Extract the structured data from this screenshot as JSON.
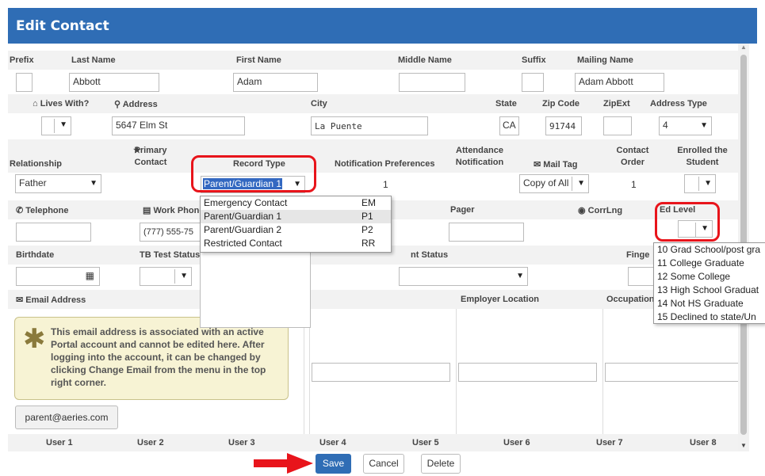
{
  "title": "Edit Contact",
  "row1": {
    "headers": {
      "prefix": "Prefix",
      "last_name": "Last Name",
      "first_name": "First Name",
      "middle_name": "Middle Name",
      "suffix": "Suffix",
      "mailing_name": "Mailing Name"
    },
    "values": {
      "prefix": "",
      "last_name": "Abbott",
      "first_name": "Adam",
      "middle_name": "",
      "suffix": "",
      "mailing_name": "Adam Abbott"
    }
  },
  "row2": {
    "headers": {
      "lives_with": "Lives With?",
      "address": "Address",
      "city": "City",
      "state": "State",
      "zip": "Zip Code",
      "zipext": "ZipExt",
      "address_type": "Address Type"
    },
    "values": {
      "lives_with": "",
      "address": "5647 Elm St",
      "city": "La Puente",
      "state": "CA",
      "zip": "91744",
      "zipext": "",
      "address_type": "4"
    }
  },
  "row3": {
    "headers": {
      "relationship": "Relationship",
      "primary_contact": "Primary\nContact",
      "record_type": "Record Type",
      "notification_prefs": "Notification Preferences",
      "attendance": "Attendance\nNotification",
      "mail_tag": "Mail Tag",
      "contact_order": "Contact\nOrder",
      "enrolled": "Enrolled the\nStudent"
    },
    "values": {
      "relationship": "Father",
      "record_type": "Parent/Guardian 1",
      "notification_prefs": "1",
      "mail_tag": "Copy of All",
      "contact_order": "1",
      "enrolled": ""
    }
  },
  "row4": {
    "headers": {
      "telephone": "Telephone",
      "work_phone": "Work Phone",
      "pager": "Pager",
      "corrlng": "CorrLng",
      "ed_level": "Ed Level"
    },
    "values": {
      "telephone": "",
      "work_phone": "(777) 555-75",
      "pager": "",
      "ed_level": ""
    }
  },
  "row5": {
    "headers": {
      "birthdate": "Birthdate",
      "tb_test": "TB Test Status",
      "status": "nt Status",
      "finger": "Finge"
    },
    "values": {
      "birthdate": "",
      "tb_test": ""
    }
  },
  "row6": {
    "headers": {
      "email": "Email Address",
      "employer_location": "Employer Location",
      "occupation": "Occupation"
    },
    "warning": "This email address is associated with an active Portal account and cannot be edited here. After logging into the account, it can be changed by clicking Change Email from the menu in the top right corner.",
    "email_value": "parent@aeries.com"
  },
  "user_headers": [
    "User 1",
    "User 2",
    "User 3",
    "User 4",
    "User 5",
    "User 6",
    "User 7",
    "User 8"
  ],
  "record_type_options": [
    {
      "label": "Emergency Contact",
      "code": "EM"
    },
    {
      "label": "Parent/Guardian 1",
      "code": "P1"
    },
    {
      "label": "Parent/Guardian 2",
      "code": "P2"
    },
    {
      "label": "Restricted Contact",
      "code": "RR"
    }
  ],
  "ed_level_options": [
    "10  Grad School/post gra",
    "11  College Graduate",
    "12  Some College",
    "13  High School Graduat",
    "14  Not HS Graduate",
    "15  Declined to state/Un"
  ],
  "buttons": {
    "save": "Save",
    "cancel": "Cancel",
    "delete": "Delete"
  },
  "colors": {
    "accent": "#2f6db5",
    "highlight": "#e8141b",
    "warning_bg": "#f7f3d4"
  }
}
